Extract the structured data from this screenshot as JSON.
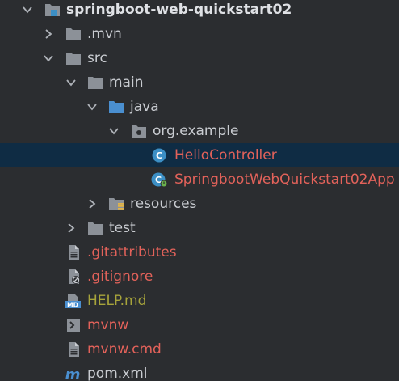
{
  "project_tree": {
    "root": {
      "label": "springboot-web-quickstart02"
    },
    "items": [
      {
        "label": ".mvn",
        "icon": "folder-icon"
      },
      {
        "label": "src",
        "icon": "folder-icon"
      },
      {
        "label": "main",
        "icon": "folder-icon"
      },
      {
        "label": "java",
        "icon": "source-folder-icon"
      },
      {
        "label": "org.example",
        "icon": "package-icon"
      },
      {
        "label": "HelloController",
        "icon": "java-class-icon",
        "selected": true
      },
      {
        "label": "SpringbootWebQuickstart02App",
        "icon": "spring-app-class-icon"
      },
      {
        "label": "resources",
        "icon": "resources-folder-icon"
      },
      {
        "label": "test",
        "icon": "folder-icon"
      },
      {
        "label": ".gitattributes",
        "icon": "file-icon"
      },
      {
        "label": ".gitignore",
        "icon": "gitignore-file-icon"
      },
      {
        "label": "HELP.md",
        "icon": "markdown-file-icon"
      },
      {
        "label": "mvnw",
        "icon": "shell-file-icon"
      },
      {
        "label": "mvnw.cmd",
        "icon": "file-icon"
      },
      {
        "label": "pom.xml",
        "icon": "maven-pom-icon"
      }
    ]
  },
  "colors": {
    "background": "#2b2d30",
    "selected_row": "#0f2c44",
    "text_default": "#c9ccd1",
    "text_untracked": "#e3625a",
    "text_modified": "#a7a43b",
    "class_icon": "#3c8fc5",
    "folder_gray": "#8c9198",
    "source_folder_blue": "#4a8fd0"
  }
}
